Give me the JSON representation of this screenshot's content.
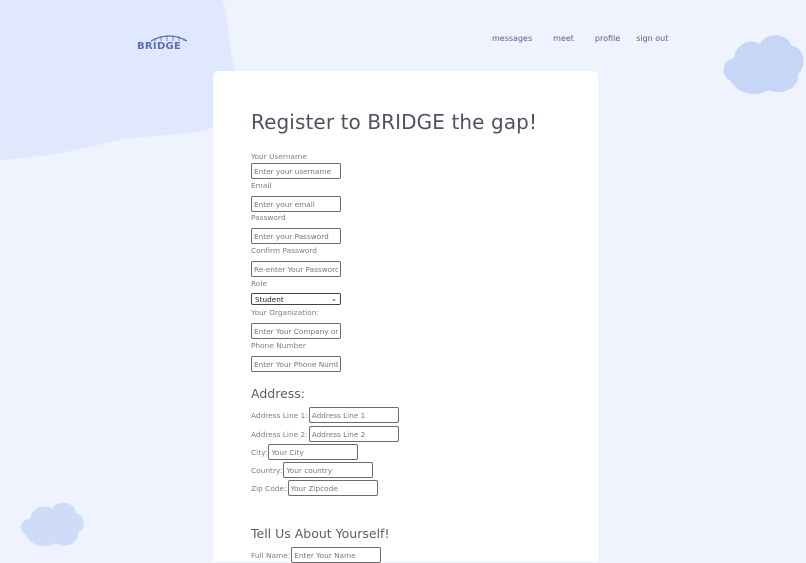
{
  "brand": {
    "logo_text": "BRIDGE"
  },
  "nav": {
    "items": [
      "messages",
      "meet",
      "profile",
      "sign out"
    ]
  },
  "form": {
    "title": "Register to BRIDGE the gap!",
    "username_label": "Your Username",
    "username_placeholder": "Enter your username",
    "email_label": "Email",
    "email_placeholder": "Enter your email",
    "password_label": "Password",
    "password_placeholder": "Enter your Password",
    "confirm_label": "Confirm Password",
    "confirm_placeholder": "Re-enter Your Password",
    "role_label": "Role",
    "role_value": "Student",
    "org_label": "Your Organization:",
    "org_placeholder": "Enter Your Company or Organization",
    "phone_label": "Phone Number",
    "phone_placeholder": "Enter Your Phone Number"
  },
  "address": {
    "heading": "Address:",
    "line1_label": "Address Line 1:",
    "line1_placeholder": "Address Line 1",
    "line2_label": "Address Line 2:",
    "line2_placeholder": "Address Line 2",
    "city_label": "City:",
    "city_placeholder": "Your City",
    "country_label": "Country:",
    "country_placeholder": "Your country",
    "zip_label": "Zip Code:",
    "zip_placeholder": "Your Zipcode"
  },
  "about": {
    "heading": "Tell Us About Yourself!",
    "fullname_label": "Full Name:",
    "fullname_placeholder": "Enter Your Name"
  },
  "colors": {
    "background": "#eef3fd",
    "blob": "#dde7fb",
    "cloud": "#c8d8f8",
    "logo": "#5a6fb4"
  }
}
